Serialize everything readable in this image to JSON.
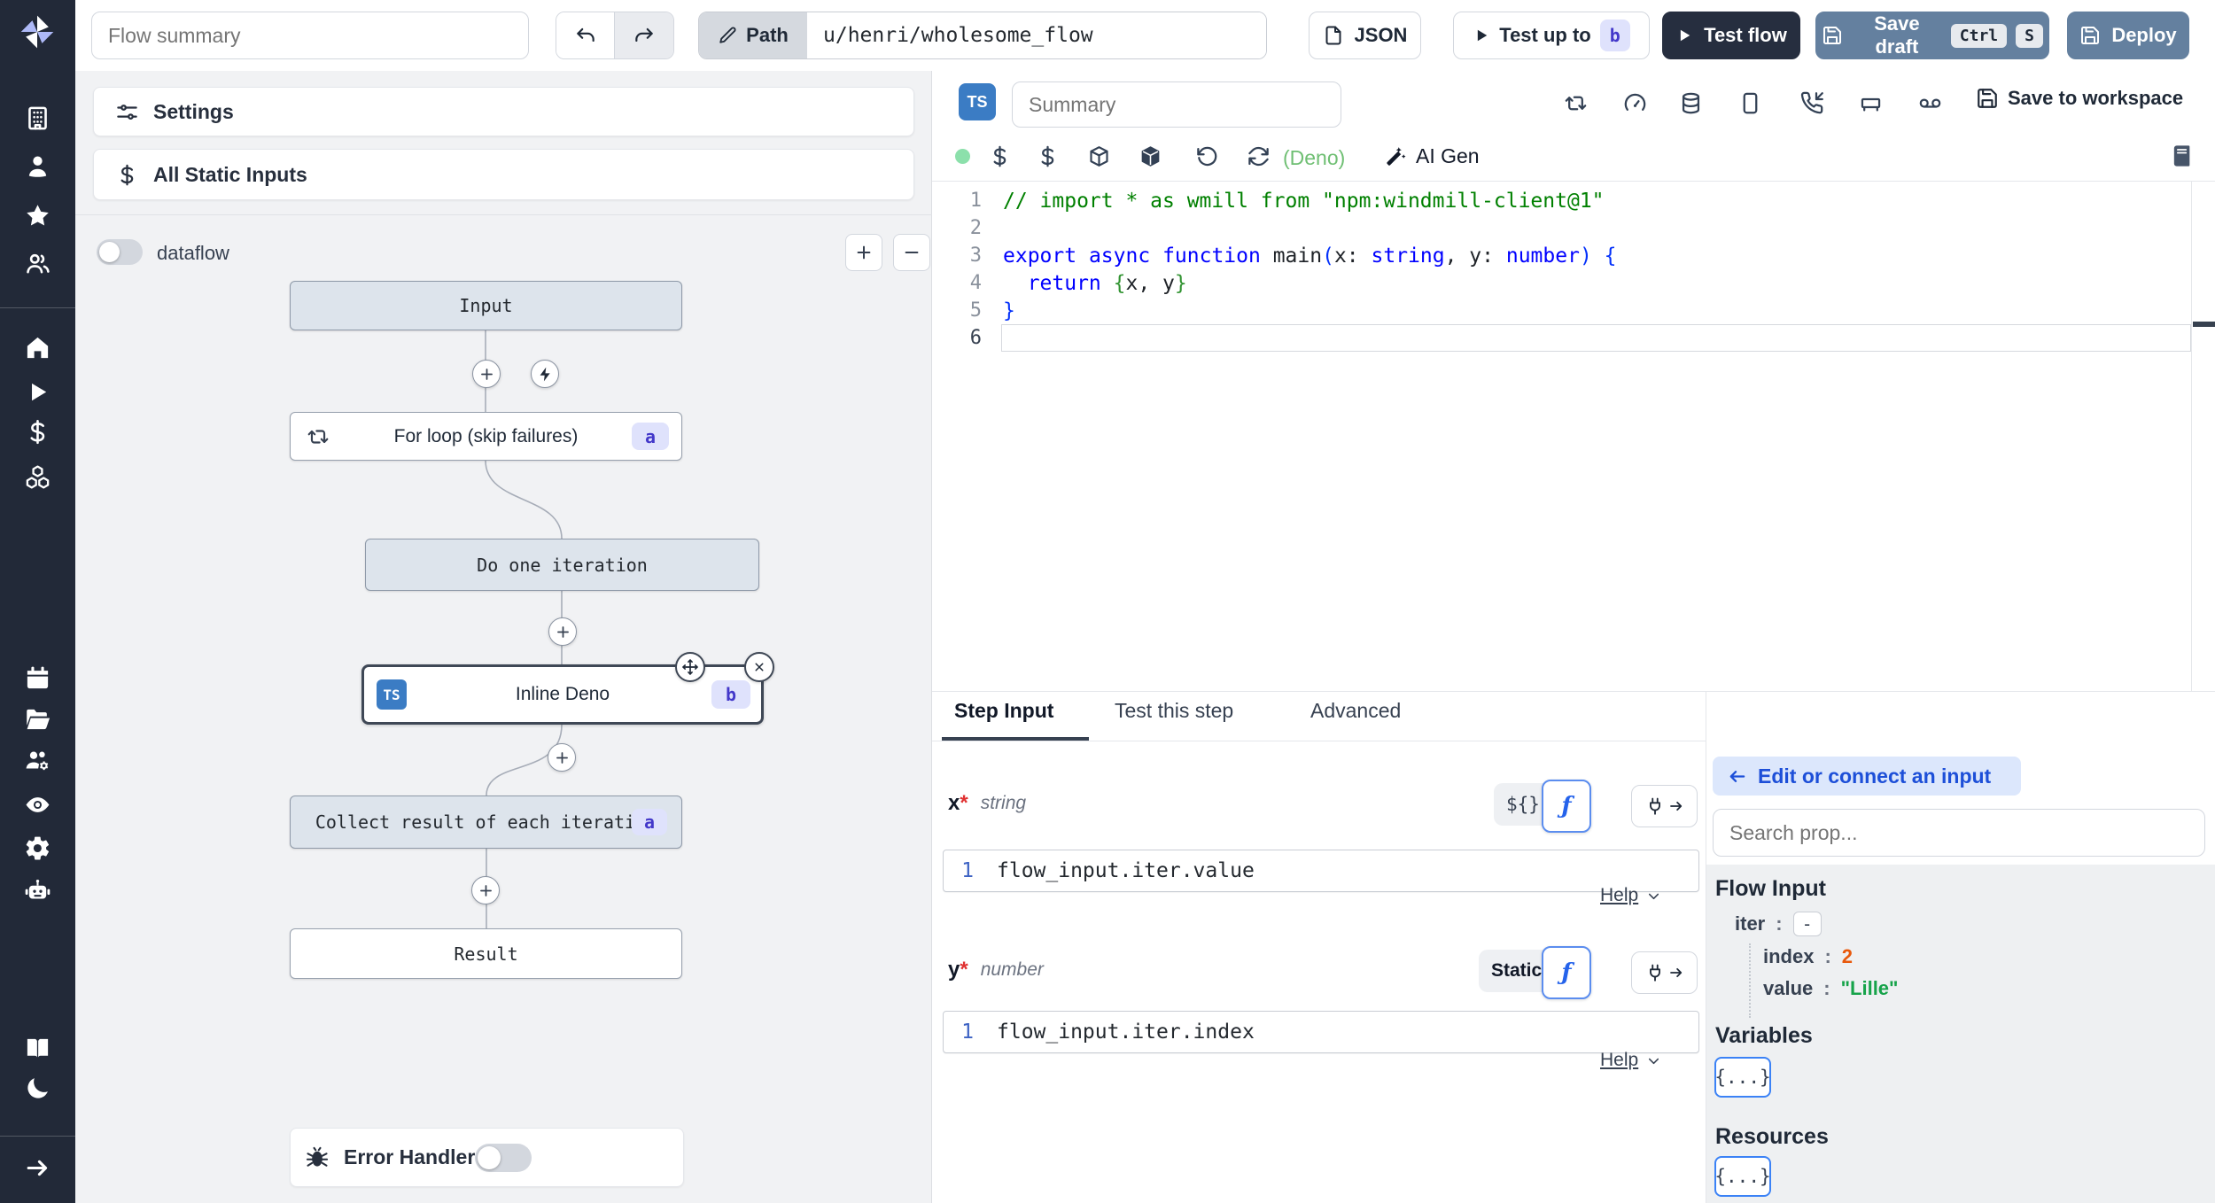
{
  "colors": {
    "sidebar_bg": "#222938",
    "accent_blue": "#3b82f6",
    "primary_button_bg": "#64809f",
    "dark_button_bg": "#262e3f",
    "badge_bg": "#dfe2fc",
    "badge_text": "#4338ca",
    "ts_badge_bg": "#3b7cc4",
    "status_dot": "#8ce0ab",
    "runtime_green": "#6fbf73",
    "index_orange": "#e8590c",
    "value_green": "#16a34a"
  },
  "topbar": {
    "flow_summary_placeholder": "Flow summary",
    "path_label": "Path",
    "path_value": "u/henri/wholesome_flow",
    "json_label": "JSON",
    "test_up_to_label": "Test up to",
    "test_up_to_badge": "b",
    "test_flow_label": "Test flow",
    "save_draft_label": "Save draft",
    "save_draft_keys": [
      "Ctrl",
      "S"
    ],
    "deploy_label": "Deploy"
  },
  "sidebar": {
    "icons": [
      "windmill-logo",
      "building",
      "user",
      "star",
      "users",
      "home",
      "play",
      "dollar",
      "boxes",
      "calendar",
      "folder-open",
      "users-cog",
      "eye",
      "gear",
      "bot",
      "book-open",
      "moon",
      "arrow-right"
    ]
  },
  "flow_panel": {
    "settings_label": "Settings",
    "all_static_inputs_label": "All Static Inputs",
    "dataflow_label": "dataflow",
    "zoom_in_label": "+",
    "zoom_out_label": "−",
    "nodes": {
      "input": {
        "label": "Input"
      },
      "forloop": {
        "label": "For loop (skip failures)",
        "badge": "a"
      },
      "iteration": {
        "label": "Do one iteration"
      },
      "inline": {
        "label": "Inline Deno",
        "badge": "b",
        "lang_badge": "TS"
      },
      "collect": {
        "label": "Collect result of each iteration",
        "badge": "a"
      },
      "result": {
        "label": "Result"
      }
    },
    "error_handler_label": "Error Handler"
  },
  "editor": {
    "lang_badge": "TS",
    "summary_placeholder": "Summary",
    "header_icons": [
      "repeat",
      "gauge",
      "database",
      "mobile",
      "phone-incoming",
      "bed",
      "voicemail"
    ],
    "save_to_workspace_label": "Save to workspace",
    "toolbar": {
      "icons": [
        "dollar",
        "dollar",
        "package",
        "package-filled",
        "rotate-ccw",
        "refresh-cw"
      ],
      "runtime_label": "(Deno)",
      "ai_gen_label": "AI Gen"
    },
    "code": {
      "active_line": "6",
      "lines": [
        {
          "n": "1",
          "parts": [
            {
              "c": "cm",
              "t": "// import * as wmill from \"npm:windmill-client@1\""
            }
          ]
        },
        {
          "n": "2",
          "parts": []
        },
        {
          "n": "3",
          "parts": [
            {
              "c": "kw",
              "t": "export"
            },
            {
              "c": "pl",
              "t": " "
            },
            {
              "c": "kw",
              "t": "async"
            },
            {
              "c": "pl",
              "t": " "
            },
            {
              "c": "kw",
              "t": "function"
            },
            {
              "c": "pl",
              "t": " main"
            },
            {
              "c": "b1",
              "t": "("
            },
            {
              "c": "pl",
              "t": "x: "
            },
            {
              "c": "kw",
              "t": "string"
            },
            {
              "c": "pl",
              "t": ", y: "
            },
            {
              "c": "kw",
              "t": "number"
            },
            {
              "c": "b1",
              "t": ")"
            },
            {
              "c": "pl",
              "t": " "
            },
            {
              "c": "b1",
              "t": "{"
            }
          ]
        },
        {
          "n": "4",
          "parts": [
            {
              "c": "kw",
              "t": "  return"
            },
            {
              "c": "pl",
              "t": " "
            },
            {
              "c": "b2",
              "t": "{"
            },
            {
              "c": "pl",
              "t": "x, y"
            },
            {
              "c": "b2",
              "t": "}"
            }
          ]
        },
        {
          "n": "5",
          "parts": [
            {
              "c": "b1",
              "t": "}"
            }
          ]
        },
        {
          "n": "6",
          "parts": []
        }
      ]
    }
  },
  "step_panel": {
    "tabs": [
      {
        "label": "Step Input",
        "active": true
      },
      {
        "label": "Test this step",
        "active": false
      },
      {
        "label": "Advanced",
        "active": false
      }
    ],
    "fields": [
      {
        "name": "x",
        "required_mark": "*",
        "type": "string",
        "mode_label": "${}",
        "fn_glyph": "ƒ",
        "line_no": "1",
        "expr": "flow_input.iter.value",
        "help_label": "Help"
      },
      {
        "name": "y",
        "required_mark": "*",
        "type": "number",
        "mode_label": "Static",
        "fn_glyph": "ƒ",
        "line_no": "1",
        "expr": "flow_input.iter.index",
        "help_label": "Help"
      }
    ]
  },
  "connect_panel": {
    "back_label": "Edit or connect an input",
    "search_placeholder": "Search prop...",
    "flow_input_title": "Flow Input",
    "props": [
      {
        "key": "iter",
        "sep": ":",
        "value": "-"
      },
      {
        "key": "index",
        "sep": ":",
        "value": "2"
      },
      {
        "key": "value",
        "sep": ":",
        "value": "\"Lille\""
      }
    ],
    "variables_title": "Variables",
    "resources_title": "Resources",
    "object_chip_label": "{...}"
  }
}
